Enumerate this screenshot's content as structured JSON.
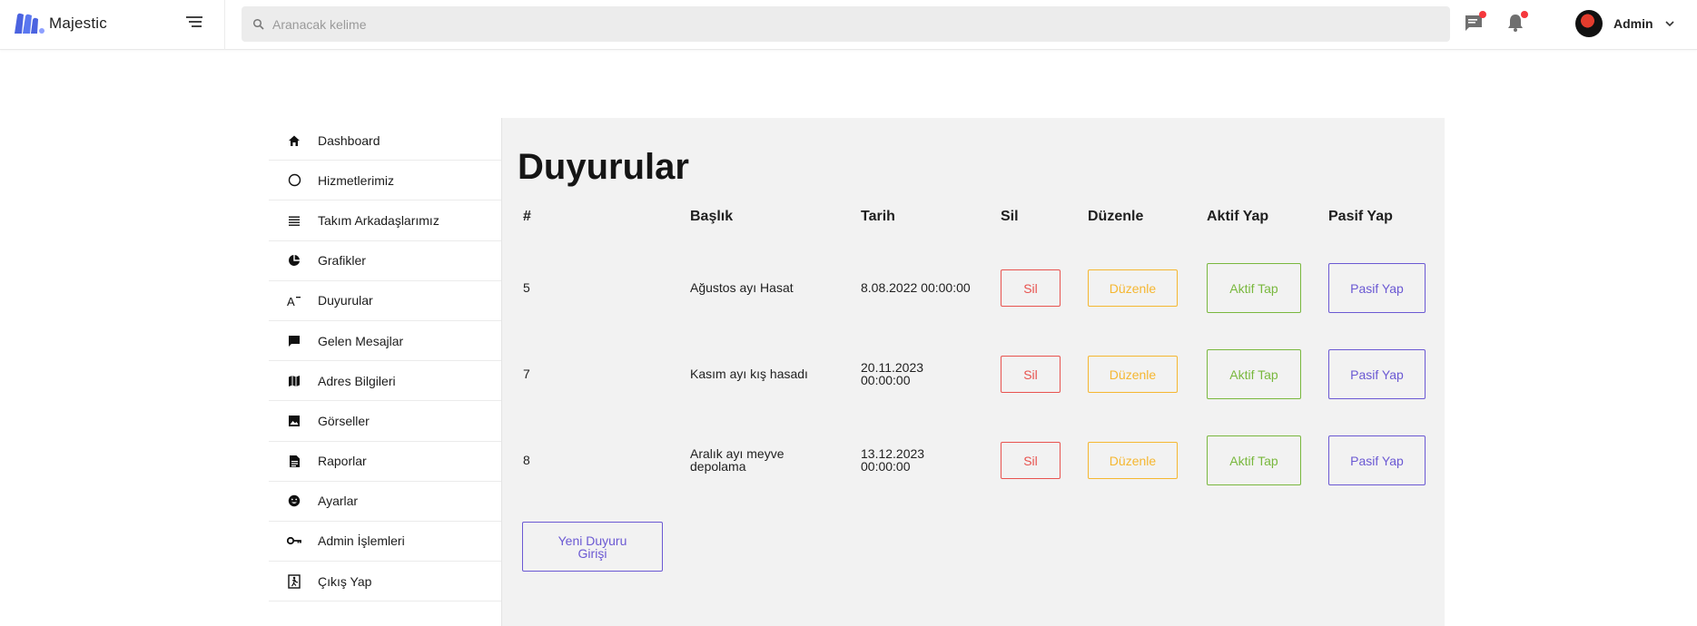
{
  "brand": {
    "name": "Majestic"
  },
  "search": {
    "placeholder": "Aranacak kelime"
  },
  "user": {
    "name": "Admin"
  },
  "sidebar": {
    "items": [
      {
        "label": "Dashboard",
        "icon": "home-icon"
      },
      {
        "label": "Hizmetlerimiz",
        "icon": "circle-icon"
      },
      {
        "label": "Takım Arkadaşlarımız",
        "icon": "list-icon"
      },
      {
        "label": "Grafikler",
        "icon": "pie-chart-icon"
      },
      {
        "label": "Duyurular",
        "icon": "text-format-icon"
      },
      {
        "label": "Gelen Mesajlar",
        "icon": "message-icon"
      },
      {
        "label": "Adres Bilgileri",
        "icon": "map-icon"
      },
      {
        "label": "Görseller",
        "icon": "image-icon"
      },
      {
        "label": "Raporlar",
        "icon": "document-icon"
      },
      {
        "label": "Ayarlar",
        "icon": "smiley-icon"
      },
      {
        "label": "Admin İşlemleri",
        "icon": "key-icon"
      },
      {
        "label": "Çıkış Yap",
        "icon": "exit-icon"
      }
    ]
  },
  "main": {
    "title": "Duyurular",
    "columns": [
      "#",
      "Başlık",
      "Tarih",
      "Sil",
      "Düzenle",
      "Aktif Yap",
      "Pasif Yap"
    ],
    "rows": [
      {
        "id": "5",
        "title": "Ağustos ayı Hasat",
        "date": "8.08.2022 00:00:00",
        "delete_label": "Sil",
        "edit_label": "Düzenle",
        "activate_label": "Aktif Tap",
        "deactivate_label": "Pasif Yap"
      },
      {
        "id": "7",
        "title": "Kasım ayı kış hasadı",
        "date": "20.11.2023 00:00:00",
        "delete_label": "Sil",
        "edit_label": "Düzenle",
        "activate_label": "Aktif Tap",
        "deactivate_label": "Pasif Yap"
      },
      {
        "id": "8",
        "title": "Aralık ayı meyve depolama",
        "date": "13.12.2023 00:00:00",
        "delete_label": "Sil",
        "edit_label": "Düzenle",
        "activate_label": "Aktif Tap",
        "deactivate_label": "Pasif Yap"
      }
    ],
    "new_button_label": "Yeni Duyuru Girişi"
  },
  "colors": {
    "delete": "#e8534f",
    "edit": "#f5b731",
    "activate": "#79b83e",
    "deactivate": "#6b59d3",
    "brand": "#4b63e0",
    "notification_dot": "#f5373c"
  }
}
